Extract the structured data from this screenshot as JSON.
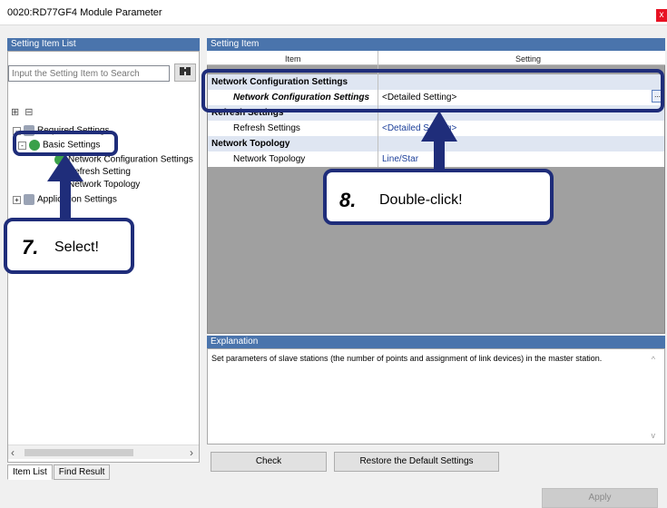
{
  "window": {
    "title": "0020:RD77GF4 Module Parameter",
    "close_label": "x"
  },
  "left_panel": {
    "header": "Setting Item List",
    "search_placeholder": "Input the Setting Item to Search",
    "find_icon": "binoculars-icon",
    "tree": {
      "required_settings": "Required Settings",
      "basic_settings": "Basic Settings",
      "network_configuration_settings": "Network Configuration Settings",
      "refresh_setting": "Refresh Setting",
      "network_topology": "Network Topology",
      "application_settings": "Application Settings"
    },
    "tabs": [
      "Item List",
      "Find Result"
    ]
  },
  "right_panel": {
    "header": "Setting Item",
    "columns": {
      "item": "Item",
      "setting": "Setting"
    },
    "rows": [
      {
        "type": "category",
        "label": "Network Configuration Settings",
        "setting": ""
      },
      {
        "type": "item",
        "label": "Network Configuration Settings",
        "setting": "<Detailed Setting>"
      },
      {
        "type": "category",
        "label": "Refresh Settings",
        "setting": ""
      },
      {
        "type": "item",
        "label": "Refresh Settings",
        "setting": "<Detailed Setting>"
      },
      {
        "type": "category",
        "label": "Network Topology",
        "setting": ""
      },
      {
        "type": "item",
        "label": "Network Topology",
        "setting": "Line/Star"
      }
    ],
    "ellipsis_label": "...",
    "explanation": {
      "header": "Explanation",
      "text": "Set parameters of slave stations (the number of points and assignment of link devices) in the master station."
    }
  },
  "buttons": {
    "check": "Check",
    "restore": "Restore the Default Settings",
    "apply": "Apply"
  },
  "callouts": {
    "step7": {
      "number": "7.",
      "text": "Select!"
    },
    "step8": {
      "number": "8.",
      "text": "Double-click!"
    }
  },
  "colors": {
    "panel_header": "#4a74ac",
    "callout_border": "#1f2d7a",
    "category_row": "#dfe6f2",
    "setting_text": "#1c3f9a"
  }
}
